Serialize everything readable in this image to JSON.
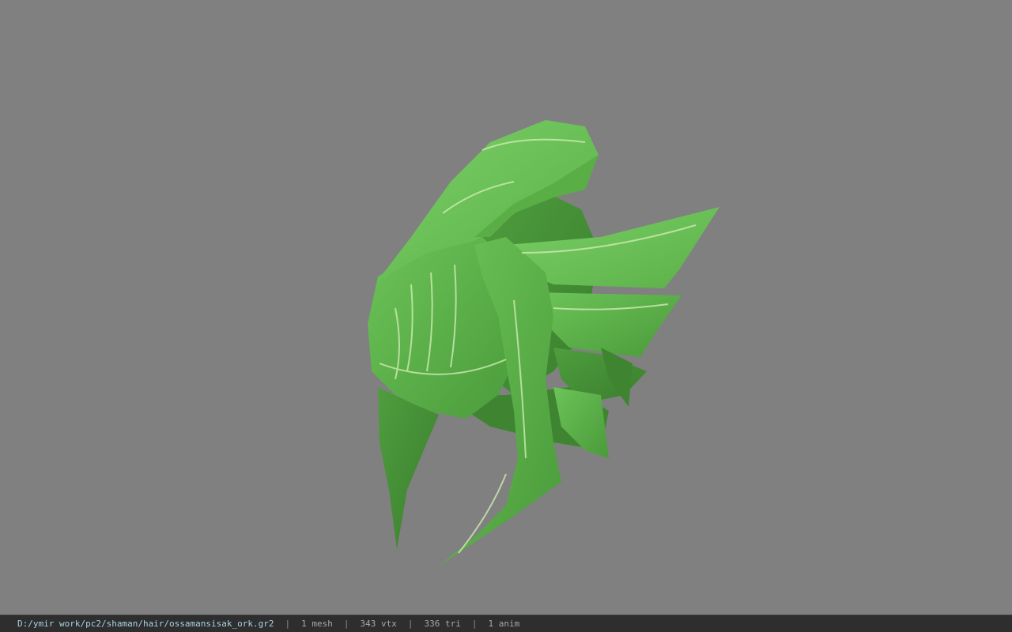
{
  "viewer": {
    "background_color": "#808080",
    "model_color": "#5fb64a"
  },
  "status": {
    "file_path": "D:/ymir work/pc2/shaman/hair/ossamansisak_ork.gr2",
    "separator": "|",
    "mesh": "1 mesh",
    "vertices": "343 vtx",
    "triangles": "336 tri",
    "animations": "1 anim"
  }
}
